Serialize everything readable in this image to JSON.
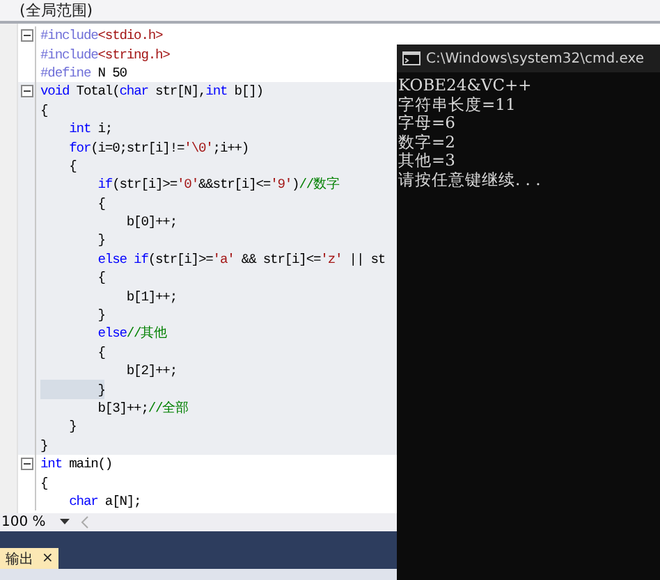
{
  "scope_bar": {
    "label": "(全局范围)"
  },
  "code_lines": [
    {
      "fold": true,
      "shaded": false,
      "selected": false,
      "tokens": [
        {
          "kind": "preprocessor",
          "text": "#include"
        },
        {
          "kind": "string",
          "text": "<stdio.h>"
        }
      ]
    },
    {
      "fold": false,
      "shaded": false,
      "selected": false,
      "tokens": [
        {
          "kind": "preprocessor",
          "text": "#include"
        },
        {
          "kind": "string",
          "text": "<string.h>"
        }
      ]
    },
    {
      "fold": false,
      "shaded": false,
      "selected": false,
      "tokens": [
        {
          "kind": "preprocessor",
          "text": "#define"
        },
        {
          "kind": "text",
          "text": " N 50"
        }
      ]
    },
    {
      "fold": true,
      "shaded": true,
      "selected": false,
      "tokens": [
        {
          "kind": "keyword",
          "text": "void"
        },
        {
          "kind": "text",
          "text": " Total("
        },
        {
          "kind": "keyword",
          "text": "char"
        },
        {
          "kind": "text",
          "text": " str[N],"
        },
        {
          "kind": "keyword",
          "text": "int"
        },
        {
          "kind": "text",
          "text": " b[])"
        }
      ]
    },
    {
      "fold": false,
      "shaded": true,
      "selected": false,
      "tokens": [
        {
          "kind": "text",
          "text": "{"
        }
      ]
    },
    {
      "fold": false,
      "shaded": true,
      "selected": false,
      "tokens": [
        {
          "kind": "keyword",
          "text": "    int"
        },
        {
          "kind": "text",
          "text": " i;"
        }
      ]
    },
    {
      "fold": false,
      "shaded": true,
      "selected": false,
      "tokens": [
        {
          "kind": "keyword",
          "text": "    for"
        },
        {
          "kind": "text",
          "text": "(i=0;str[i]!="
        },
        {
          "kind": "string",
          "text": "'\\0'"
        },
        {
          "kind": "text",
          "text": ";i++)"
        }
      ]
    },
    {
      "fold": false,
      "shaded": true,
      "selected": false,
      "tokens": [
        {
          "kind": "text",
          "text": "    {"
        }
      ]
    },
    {
      "fold": false,
      "shaded": true,
      "selected": false,
      "tokens": [
        {
          "kind": "keyword",
          "text": "        if"
        },
        {
          "kind": "text",
          "text": "(str[i]>="
        },
        {
          "kind": "string",
          "text": "'0'"
        },
        {
          "kind": "text",
          "text": "&&str[i]<="
        },
        {
          "kind": "string",
          "text": "'9'"
        },
        {
          "kind": "text",
          "text": ")"
        },
        {
          "kind": "comment",
          "text": "//数字"
        }
      ]
    },
    {
      "fold": false,
      "shaded": true,
      "selected": false,
      "tokens": [
        {
          "kind": "text",
          "text": "        {"
        }
      ]
    },
    {
      "fold": false,
      "shaded": true,
      "selected": false,
      "tokens": [
        {
          "kind": "text",
          "text": "            b[0]++;"
        }
      ]
    },
    {
      "fold": false,
      "shaded": true,
      "selected": false,
      "tokens": [
        {
          "kind": "text",
          "text": "        }"
        }
      ]
    },
    {
      "fold": false,
      "shaded": true,
      "selected": false,
      "tokens": [
        {
          "kind": "keyword",
          "text": "        else if"
        },
        {
          "kind": "text",
          "text": "(str[i]>="
        },
        {
          "kind": "string",
          "text": "'a'"
        },
        {
          "kind": "text",
          "text": " && str[i]<="
        },
        {
          "kind": "string",
          "text": "'z'"
        },
        {
          "kind": "text",
          "text": " || st"
        }
      ]
    },
    {
      "fold": false,
      "shaded": true,
      "selected": false,
      "tokens": [
        {
          "kind": "text",
          "text": "        {"
        }
      ]
    },
    {
      "fold": false,
      "shaded": true,
      "selected": false,
      "tokens": [
        {
          "kind": "text",
          "text": "            b[1]++;"
        }
      ]
    },
    {
      "fold": false,
      "shaded": true,
      "selected": false,
      "tokens": [
        {
          "kind": "text",
          "text": "        }"
        }
      ]
    },
    {
      "fold": false,
      "shaded": true,
      "selected": false,
      "tokens": [
        {
          "kind": "keyword",
          "text": "        else"
        },
        {
          "kind": "comment",
          "text": "//其他"
        }
      ]
    },
    {
      "fold": false,
      "shaded": true,
      "selected": false,
      "tokens": [
        {
          "kind": "text",
          "text": "        {"
        }
      ]
    },
    {
      "fold": false,
      "shaded": true,
      "selected": false,
      "tokens": [
        {
          "kind": "text",
          "text": "            b[2]++;"
        }
      ]
    },
    {
      "fold": false,
      "shaded": true,
      "selected": true,
      "tokens": [
        {
          "kind": "text",
          "text": "        }"
        }
      ]
    },
    {
      "fold": false,
      "shaded": true,
      "selected": false,
      "tokens": [
        {
          "kind": "text",
          "text": "        b[3]++;"
        },
        {
          "kind": "comment",
          "text": "//全部"
        }
      ]
    },
    {
      "fold": false,
      "shaded": true,
      "selected": false,
      "tokens": [
        {
          "kind": "text",
          "text": "    }"
        }
      ]
    },
    {
      "fold": false,
      "shaded": true,
      "selected": false,
      "tokens": [
        {
          "kind": "text",
          "text": "}"
        }
      ]
    },
    {
      "fold": true,
      "shaded": false,
      "selected": false,
      "tokens": [
        {
          "kind": "keyword",
          "text": "int"
        },
        {
          "kind": "text",
          "text": " main()"
        }
      ]
    },
    {
      "fold": false,
      "shaded": false,
      "selected": false,
      "tokens": [
        {
          "kind": "text",
          "text": "{"
        }
      ]
    },
    {
      "fold": false,
      "shaded": false,
      "selected": false,
      "tokens": [
        {
          "kind": "keyword",
          "text": "    char"
        },
        {
          "kind": "text",
          "text": " a[N];"
        }
      ]
    }
  ],
  "zoom": {
    "value": "100 %"
  },
  "output_tab": {
    "label": "输出",
    "close": "×"
  },
  "console": {
    "title": "C:\\Windows\\system32\\cmd.exe",
    "lines": [
      "KOBE24&VC++",
      "字符串长度=11",
      "字母=6",
      "数字=2",
      "其他=3",
      "请按任意键继续. . ."
    ]
  }
}
